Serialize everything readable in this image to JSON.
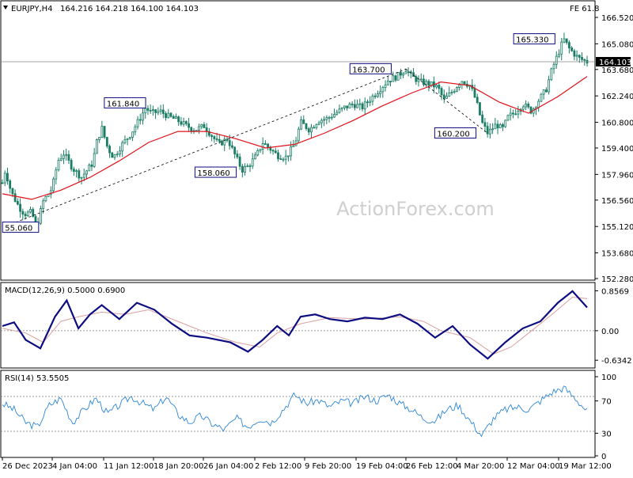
{
  "header": {
    "symbol": "EURJPY,H4",
    "ohlc": "164.216 164.218 164.100 164.103",
    "fe_label": "FE 61.8"
  },
  "watermark": "ActionForex.com",
  "colors": {
    "background": "#ffffff",
    "candle": "#1a7d64",
    "ma": "#e0101a",
    "macd": "#0d0d82",
    "macd_signal": "#d9a0a0",
    "rsi": "#2d86d6",
    "grid_level": "#7a7a7a"
  },
  "chart_data": [
    {
      "type": "line",
      "name": "price",
      "title": "EURJPY,H4",
      "ylim": [
        152.28,
        166.52
      ],
      "y_ticks": [
        "166.520",
        "165.080",
        "163.680",
        "162.240",
        "160.800",
        "159.400",
        "157.960",
        "156.560",
        "155.120",
        "153.680",
        "152.280"
      ],
      "current_price": "164.103",
      "fe_level": "FE 61.8",
      "annotations": [
        {
          "text": "55.060",
          "x": "26 Dec 2023",
          "y": 155.06
        },
        {
          "text": "161.840",
          "x": "12 Jan 2024",
          "y": 161.84
        },
        {
          "text": "158.060",
          "x": "29 Jan 2024",
          "y": 158.06
        },
        {
          "text": "163.700",
          "x": "22 Feb 2024",
          "y": 163.7
        },
        {
          "text": "160.200",
          "x": "7 Mar 2024",
          "y": 160.2
        },
        {
          "text": "165.330",
          "x": "18 Mar 2024",
          "y": 165.33
        }
      ],
      "trendlines": [
        {
          "from": [
            0,
            155.06
          ],
          "to": [
            0.69,
            163.7
          ]
        },
        {
          "from": [
            0.69,
            163.7
          ],
          "to": [
            0.83,
            160.2
          ]
        }
      ],
      "price_points": [
        [
          0.0,
          157.5
        ],
        [
          0.005,
          158.2
        ],
        [
          0.015,
          157.0
        ],
        [
          0.028,
          156.2
        ],
        [
          0.038,
          155.8
        ],
        [
          0.05,
          155.9
        ],
        [
          0.058,
          155.06
        ],
        [
          0.07,
          156.5
        ],
        [
          0.085,
          157.2
        ],
        [
          0.095,
          158.7
        ],
        [
          0.105,
          159.1
        ],
        [
          0.12,
          158.3
        ],
        [
          0.135,
          157.8
        ],
        [
          0.155,
          158.6
        ],
        [
          0.16,
          159.6
        ],
        [
          0.17,
          160.5
        ],
        [
          0.18,
          159.4
        ],
        [
          0.19,
          158.9
        ],
        [
          0.205,
          159.6
        ],
        [
          0.22,
          160.2
        ],
        [
          0.235,
          161.0
        ],
        [
          0.245,
          161.6
        ],
        [
          0.255,
          161.3
        ],
        [
          0.27,
          161.4
        ],
        [
          0.285,
          161.1
        ],
        [
          0.3,
          160.9
        ],
        [
          0.315,
          160.6
        ],
        [
          0.33,
          160.4
        ],
        [
          0.345,
          160.6
        ],
        [
          0.355,
          160.2
        ],
        [
          0.37,
          159.6
        ],
        [
          0.385,
          159.9
        ],
        [
          0.395,
          159.2
        ],
        [
          0.41,
          158.2
        ],
        [
          0.42,
          158.4
        ],
        [
          0.435,
          159.0
        ],
        [
          0.445,
          159.7
        ],
        [
          0.46,
          159.3
        ],
        [
          0.47,
          159.0
        ],
        [
          0.485,
          158.9
        ],
        [
          0.5,
          159.6
        ],
        [
          0.51,
          160.8
        ],
        [
          0.525,
          160.4
        ],
        [
          0.54,
          160.9
        ],
        [
          0.555,
          161.0
        ],
        [
          0.57,
          161.3
        ],
        [
          0.585,
          161.6
        ],
        [
          0.6,
          161.8
        ],
        [
          0.615,
          161.6
        ],
        [
          0.63,
          162.1
        ],
        [
          0.645,
          162.6
        ],
        [
          0.66,
          163.1
        ],
        [
          0.675,
          163.3
        ],
        [
          0.69,
          163.7
        ],
        [
          0.7,
          163.3
        ],
        [
          0.715,
          163.0
        ],
        [
          0.73,
          162.9
        ],
        [
          0.745,
          162.7
        ],
        [
          0.755,
          162.0
        ],
        [
          0.77,
          162.5
        ],
        [
          0.785,
          163.1
        ],
        [
          0.8,
          162.8
        ],
        [
          0.81,
          162.0
        ],
        [
          0.82,
          160.8
        ],
        [
          0.83,
          160.2
        ],
        [
          0.845,
          160.7
        ],
        [
          0.855,
          160.4
        ],
        [
          0.865,
          161.1
        ],
        [
          0.875,
          161.3
        ],
        [
          0.89,
          161.8
        ],
        [
          0.905,
          161.4
        ],
        [
          0.915,
          161.9
        ],
        [
          0.93,
          162.6
        ],
        [
          0.94,
          163.7
        ],
        [
          0.95,
          164.5
        ],
        [
          0.96,
          165.33
        ],
        [
          0.97,
          164.8
        ],
        [
          0.985,
          164.3
        ],
        [
          1.0,
          164.1
        ]
      ],
      "ma_points": [
        [
          0.0,
          156.9
        ],
        [
          0.05,
          156.6
        ],
        [
          0.1,
          157.1
        ],
        [
          0.15,
          157.8
        ],
        [
          0.2,
          158.7
        ],
        [
          0.25,
          159.7
        ],
        [
          0.3,
          160.3
        ],
        [
          0.35,
          160.3
        ],
        [
          0.4,
          159.9
        ],
        [
          0.45,
          159.4
        ],
        [
          0.5,
          159.6
        ],
        [
          0.55,
          160.2
        ],
        [
          0.6,
          160.9
        ],
        [
          0.65,
          161.7
        ],
        [
          0.7,
          162.4
        ],
        [
          0.75,
          163.0
        ],
        [
          0.8,
          162.8
        ],
        [
          0.85,
          161.9
        ],
        [
          0.9,
          161.3
        ],
        [
          0.95,
          162.2
        ],
        [
          1.0,
          163.3
        ]
      ]
    },
    {
      "type": "line",
      "name": "MACD",
      "title": "MACD(12,26,9) 0.5000 0.6900",
      "ylim": [
        -0.75,
        0.95
      ],
      "y_ticks": [
        "0.8569",
        "0.00",
        "-0.6342"
      ],
      "macd_points": [
        [
          0.0,
          0.1
        ],
        [
          0.02,
          0.18
        ],
        [
          0.04,
          -0.2
        ],
        [
          0.065,
          -0.38
        ],
        [
          0.09,
          0.3
        ],
        [
          0.11,
          0.65
        ],
        [
          0.13,
          0.05
        ],
        [
          0.15,
          0.35
        ],
        [
          0.17,
          0.55
        ],
        [
          0.2,
          0.25
        ],
        [
          0.23,
          0.6
        ],
        [
          0.26,
          0.45
        ],
        [
          0.29,
          0.15
        ],
        [
          0.32,
          -0.1
        ],
        [
          0.35,
          -0.15
        ],
        [
          0.39,
          -0.25
        ],
        [
          0.42,
          -0.45
        ],
        [
          0.445,
          -0.2
        ],
        [
          0.47,
          0.1
        ],
        [
          0.49,
          -0.1
        ],
        [
          0.51,
          0.3
        ],
        [
          0.535,
          0.35
        ],
        [
          0.56,
          0.25
        ],
        [
          0.59,
          0.2
        ],
        [
          0.62,
          0.28
        ],
        [
          0.65,
          0.25
        ],
        [
          0.68,
          0.35
        ],
        [
          0.71,
          0.15
        ],
        [
          0.74,
          -0.15
        ],
        [
          0.77,
          0.1
        ],
        [
          0.8,
          -0.3
        ],
        [
          0.83,
          -0.6
        ],
        [
          0.86,
          -0.25
        ],
        [
          0.89,
          0.05
        ],
        [
          0.92,
          0.2
        ],
        [
          0.95,
          0.6
        ],
        [
          0.975,
          0.85
        ],
        [
          1.0,
          0.5
        ]
      ],
      "signal_points": [
        [
          0.0,
          0.05
        ],
        [
          0.04,
          -0.05
        ],
        [
          0.07,
          -0.25
        ],
        [
          0.1,
          0.2
        ],
        [
          0.13,
          0.3
        ],
        [
          0.17,
          0.4
        ],
        [
          0.21,
          0.35
        ],
        [
          0.25,
          0.45
        ],
        [
          0.3,
          0.2
        ],
        [
          0.35,
          -0.05
        ],
        [
          0.4,
          -0.25
        ],
        [
          0.44,
          -0.35
        ],
        [
          0.47,
          -0.05
        ],
        [
          0.51,
          0.15
        ],
        [
          0.56,
          0.28
        ],
        [
          0.62,
          0.25
        ],
        [
          0.68,
          0.3
        ],
        [
          0.72,
          0.2
        ],
        [
          0.75,
          0.0
        ],
        [
          0.8,
          -0.15
        ],
        [
          0.84,
          -0.5
        ],
        [
          0.87,
          -0.35
        ],
        [
          0.9,
          -0.05
        ],
        [
          0.94,
          0.35
        ],
        [
          0.975,
          0.72
        ],
        [
          1.0,
          0.69
        ]
      ]
    },
    {
      "type": "line",
      "name": "RSI",
      "title": "RSI(14) 53.5505",
      "ylim": [
        0,
        100
      ],
      "y_ticks": [
        "100",
        "70",
        "30",
        "0"
      ],
      "levels": [
        70,
        30
      ],
      "rsi_points": [
        [
          0.0,
          62
        ],
        [
          0.02,
          55
        ],
        [
          0.04,
          40
        ],
        [
          0.06,
          35
        ],
        [
          0.08,
          60
        ],
        [
          0.1,
          68
        ],
        [
          0.12,
          40
        ],
        [
          0.14,
          55
        ],
        [
          0.16,
          68
        ],
        [
          0.18,
          50
        ],
        [
          0.2,
          60
        ],
        [
          0.22,
          70
        ],
        [
          0.24,
          62
        ],
        [
          0.26,
          55
        ],
        [
          0.28,
          70
        ],
        [
          0.3,
          50
        ],
        [
          0.32,
          40
        ],
        [
          0.34,
          48
        ],
        [
          0.36,
          38
        ],
        [
          0.38,
          32
        ],
        [
          0.4,
          45
        ],
        [
          0.42,
          35
        ],
        [
          0.44,
          45
        ],
        [
          0.46,
          40
        ],
        [
          0.48,
          55
        ],
        [
          0.5,
          72
        ],
        [
          0.52,
          62
        ],
        [
          0.54,
          66
        ],
        [
          0.56,
          58
        ],
        [
          0.58,
          65
        ],
        [
          0.6,
          62
        ],
        [
          0.62,
          70
        ],
        [
          0.64,
          65
        ],
        [
          0.66,
          72
        ],
        [
          0.68,
          62
        ],
        [
          0.7,
          55
        ],
        [
          0.72,
          45
        ],
        [
          0.74,
          42
        ],
        [
          0.76,
          55
        ],
        [
          0.78,
          60
        ],
        [
          0.8,
          42
        ],
        [
          0.82,
          25
        ],
        [
          0.84,
          45
        ],
        [
          0.86,
          55
        ],
        [
          0.88,
          58
        ],
        [
          0.9,
          55
        ],
        [
          0.92,
          65
        ],
        [
          0.94,
          75
        ],
        [
          0.96,
          80
        ],
        [
          0.98,
          68
        ],
        [
          1.0,
          53
        ]
      ]
    }
  ],
  "x_axis_labels": [
    "26 Dec 2023",
    "4 Jan 04:00",
    "11 Jan 12:00",
    "18 Jan 20:00",
    "26 Jan 04:00",
    "2 Feb 12:00",
    "9 Feb 20:00",
    "19 Feb 04:00",
    "26 Feb 12:00",
    "4 Mar 20:00",
    "12 Mar 04:00",
    "19 Mar 12:00"
  ]
}
